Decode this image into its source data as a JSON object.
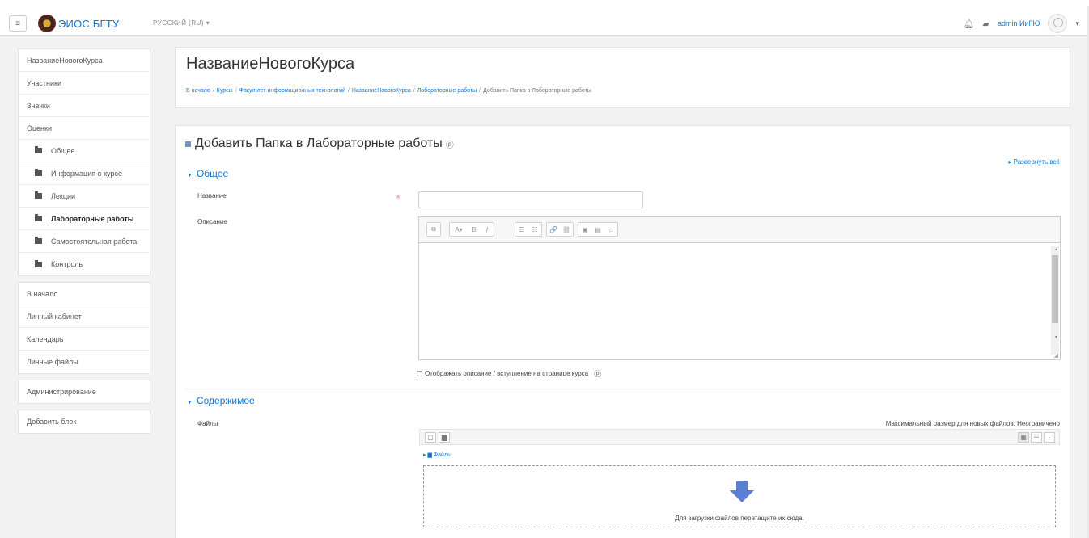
{
  "navbar": {
    "site_name": "ЭИОС БГТУ",
    "language": "РУССКИЙ (RU) ▾",
    "user_name": "admin ИиГЮ",
    "icons": [
      "menu-icon",
      "bell-icon",
      "chat-icon"
    ]
  },
  "sidebar": {
    "course": [
      {
        "label": "НазваниеНовогоКурса",
        "name": "sidebar-item-course"
      },
      {
        "label": "Участники",
        "name": "sidebar-item-participants"
      },
      {
        "label": "Значки",
        "name": "sidebar-item-badges"
      },
      {
        "label": "Оценки",
        "name": "sidebar-item-grades"
      }
    ],
    "sections": [
      {
        "label": "Общее"
      },
      {
        "label": "Информация о курсе"
      },
      {
        "label": "Лекции"
      },
      {
        "label": "Лабораторные работы",
        "active": true
      },
      {
        "label": "Самостоятельная работа"
      },
      {
        "label": "Контроль"
      }
    ],
    "site": [
      {
        "label": "В начало"
      },
      {
        "label": "Личный кабинет"
      },
      {
        "label": "Календарь"
      },
      {
        "label": "Личные файлы"
      }
    ],
    "admin": "Администрирование",
    "add_block": "Добавить блок"
  },
  "header": {
    "course_title": "НазваниеНовогоКурса",
    "breadcrumb": [
      "В начало",
      "Курсы",
      "Факультет информационных технологий",
      "НазваниеНовогоКурса",
      "Лабораторные работы",
      "Добавить Папка в Лабораторные работы"
    ]
  },
  "form": {
    "heading": "Добавить Папка в Лабораторные работы",
    "expand_all": "▸ Развернуть всё",
    "section_general": "Общее",
    "name_label": "Название",
    "name_value": "",
    "description_label": "Описание",
    "toolbar_buttons": [
      "⧉",
      "A▾",
      "B",
      "I",
      "☰",
      "☷",
      "🔗",
      "⛓",
      "▣",
      "▤",
      "⌂"
    ],
    "show_description": "Отображать описание / вступление на странице курса",
    "section_content": "Содержимое",
    "files_label": "Файлы",
    "max_size": "Максимальный размер для новых файлов: Неограничено",
    "files_path": "Файлы",
    "drop_text": "Для загрузки файлов перетащите их сюда."
  },
  "colors": {
    "link": "#1177d1",
    "drop_arrow": "#5c7fd6"
  }
}
